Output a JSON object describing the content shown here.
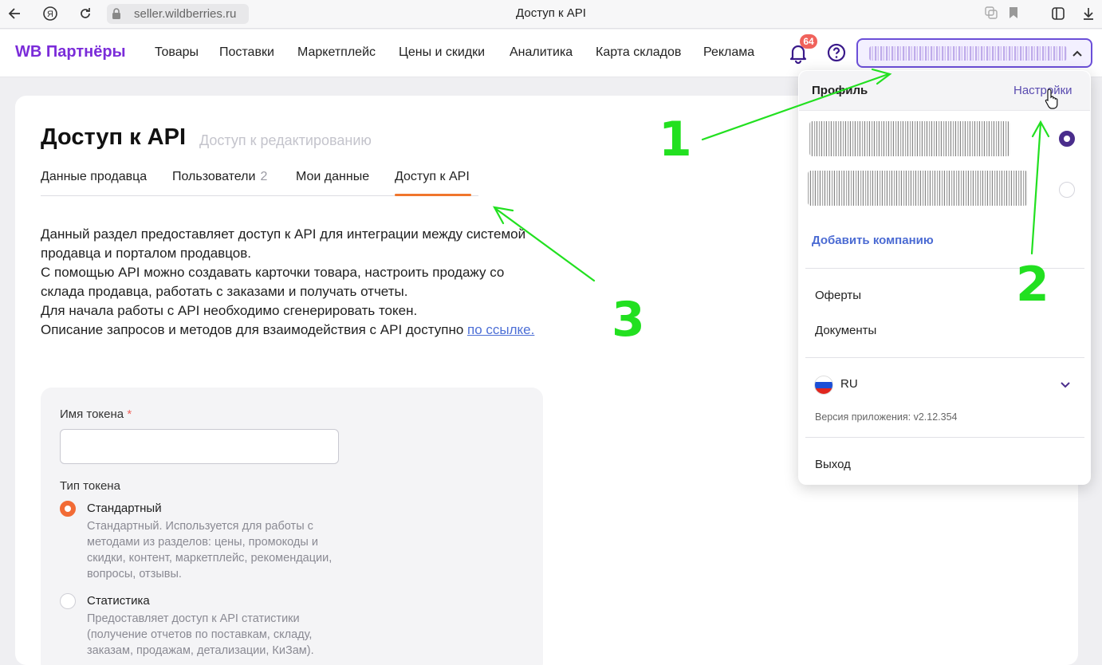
{
  "browser": {
    "url": "seller.wildberries.ru",
    "tab_title": "Доступ к API"
  },
  "navbar": {
    "logo": "WB Партнёры",
    "items": [
      "Товары",
      "Поставки",
      "Маркетплейс",
      "Цены и скидки",
      "Аналитика",
      "Карта складов",
      "Реклама"
    ],
    "notifications_count": "64"
  },
  "page": {
    "title": "Доступ к API",
    "subtitle": "Доступ к редактированию",
    "tabs": [
      {
        "label": "Данные продавца"
      },
      {
        "label": "Пользователи",
        "count": "2"
      },
      {
        "label": "Мои данные"
      },
      {
        "label": "Доступ к API",
        "active": true
      }
    ],
    "description": [
      "Данный раздел предоставляет доступ к API для интеграции между системой продавца и порталом продавцов.",
      "С помощью API можно создавать карточки товара, настроить продажу со склада продавца, работать с заказами и получать отчеты.",
      "Для начала работы с API необходимо сгенерировать токен."
    ],
    "desc_last_text": "Описание запросов и методов для взаимодействия с API доступно ",
    "desc_link": "по ссылке."
  },
  "form": {
    "token_name_label": "Имя токена",
    "required_mark": "*",
    "token_name_value": "",
    "token_type_label": "Тип токена",
    "options": [
      {
        "title": "Стандартный",
        "desc": "Стандартный. Используется для работы с методами из разделов: цены, промокоды и скидки, контент, маркетплейс, рекомендации, вопросы, отзывы.",
        "selected": true
      },
      {
        "title": "Статистика",
        "desc": "Предоставляет доступ к API статистики (получение отчетов по поставкам, складу, заказам, продажам, детализации, КиЗам).",
        "selected": false
      }
    ]
  },
  "dropdown": {
    "profile": "Профиль",
    "settings": "Настройки",
    "add_company": "Добавить компанию",
    "offers": "Оферты",
    "documents": "Документы",
    "language": "RU",
    "version": "Версия приложения: v2.12.354",
    "logout": "Выход"
  },
  "annotations": [
    "1",
    "2",
    "3"
  ],
  "colors": {
    "brand": "#7b2cd9",
    "accent": "#f26b35",
    "annotation": "#22e020",
    "link": "#4b6bd3"
  }
}
